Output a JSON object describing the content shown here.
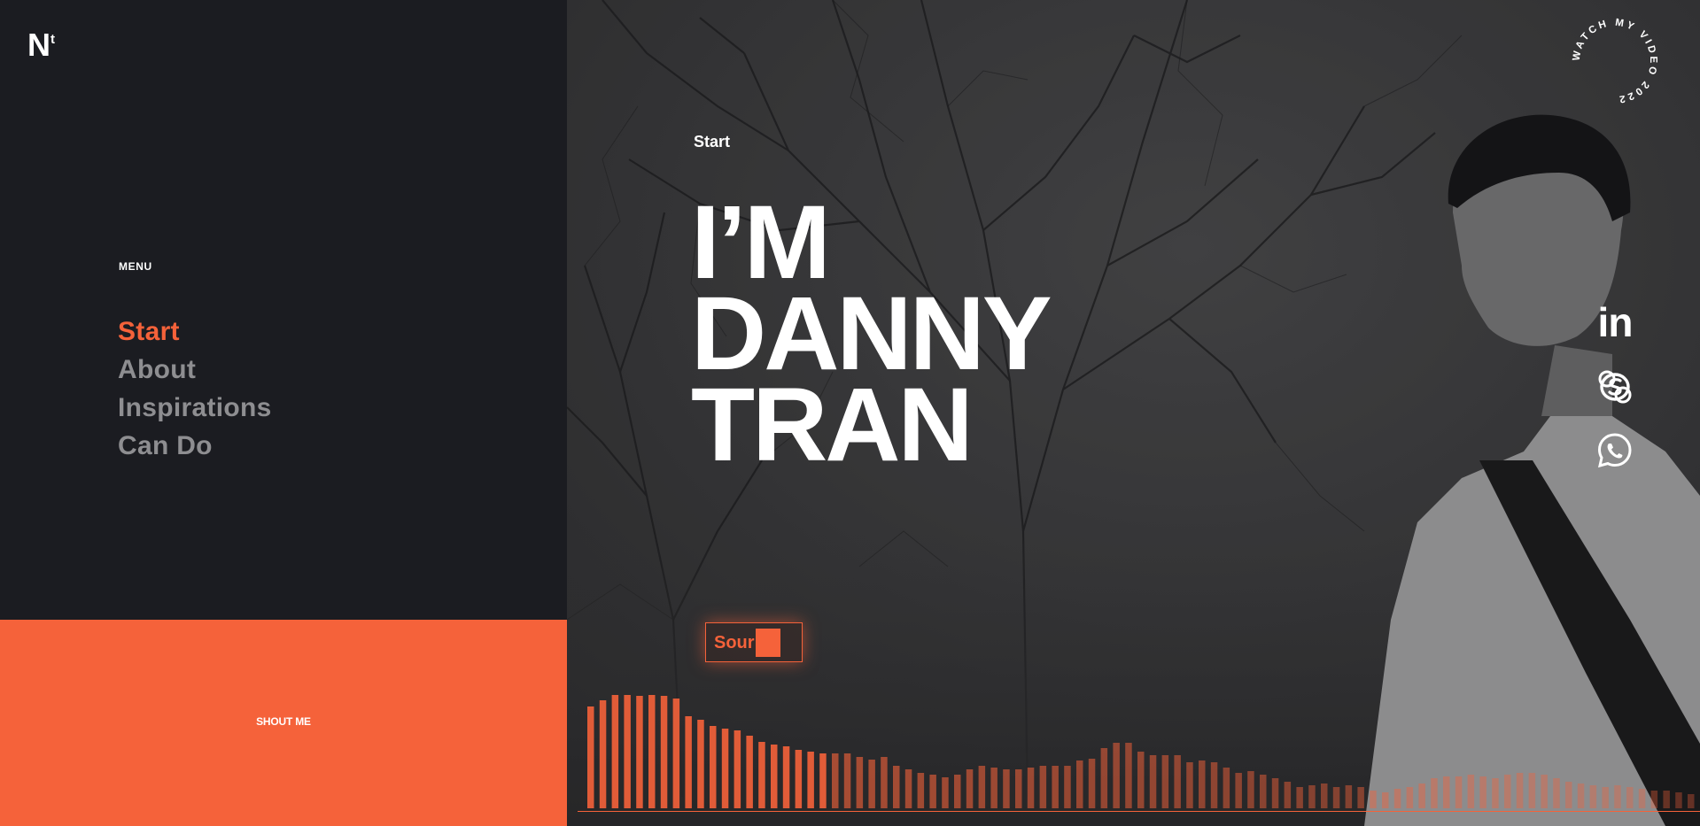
{
  "brand": {
    "logo_main": "N",
    "logo_sup": "t"
  },
  "sidebar": {
    "menu_label": "MENU",
    "items": [
      {
        "label": "Start",
        "active": true
      },
      {
        "label": "About",
        "active": false
      },
      {
        "label": "Inspirations",
        "active": false
      },
      {
        "label": "Can Do",
        "active": false
      }
    ],
    "shout_label": "SHOUT ME"
  },
  "hero": {
    "section_label": "Start",
    "title_lines": [
      "I’M",
      "DANNY",
      "TRAN"
    ],
    "sound_label": "Sour",
    "watch_badge_text": "WATCH MY VIDEO 2022"
  },
  "social": [
    {
      "name": "linkedin-icon",
      "glyph": "in"
    },
    {
      "name": "skype-icon"
    },
    {
      "name": "whatsapp-icon"
    }
  ],
  "colors": {
    "accent": "#f5623a",
    "sidebar_bg": "#1b1c21",
    "menu_inactive": "#8e8e91",
    "text": "#ffffff"
  }
}
